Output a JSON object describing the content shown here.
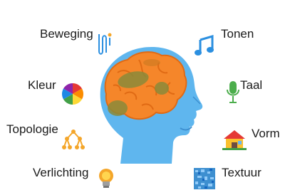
{
  "labels": {
    "beweging": "Beweging",
    "tonen": "Tonen",
    "kleur": "Kleur",
    "taal": "Taal",
    "topologie": "Topologie",
    "vorm": "Vorm",
    "verlichting": "Verlichting",
    "textuur": "Textuur"
  },
  "icons": {
    "beweging": "motion-path-icon",
    "tonen": "music-note-icon",
    "kleur": "color-wheel-icon",
    "taal": "microphone-icon",
    "topologie": "tree-network-icon",
    "vorm": "house-icon",
    "verlichting": "light-bulb-icon",
    "textuur": "texture-swatch-icon"
  },
  "colors": {
    "head": "#5fb6ee",
    "head_dark": "#3d8fd0",
    "brain": "#f5862a",
    "brain_dark": "#e06a14",
    "brain_regions": "#8a8a3a",
    "note": "#2b8fe0",
    "mic": "#4cae4c",
    "bulb": "#f4a62a"
  }
}
